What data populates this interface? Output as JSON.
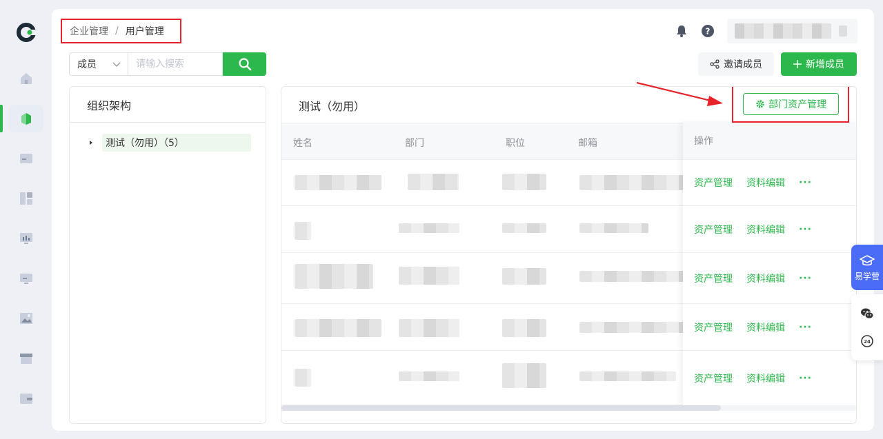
{
  "colors": {
    "brand": "#2db84d",
    "highlight": "#e8222a",
    "learn": "#4a6cf7"
  },
  "sidebar": {
    "logo_icon": "brand-logo-icon",
    "items": [
      {
        "icon": "home-icon"
      },
      {
        "icon": "org-icon",
        "active": true
      },
      {
        "icon": "folder-icon"
      },
      {
        "icon": "grid-icon"
      },
      {
        "icon": "monitor-chart-icon"
      },
      {
        "icon": "display-icon"
      },
      {
        "icon": "image-icon"
      },
      {
        "icon": "box-icon"
      },
      {
        "icon": "wallet-icon"
      }
    ]
  },
  "breadcrumb": {
    "first": "企业管理",
    "separator": "/",
    "current": "用户管理"
  },
  "header": {
    "bell_icon": "bell-icon",
    "help_icon": "help-icon"
  },
  "search": {
    "type_label": "成员",
    "placeholder": "请输入搜索"
  },
  "actions": {
    "invite_label": "邀请成员",
    "add_label": "新增成员"
  },
  "org": {
    "title": "组织架构",
    "tree": [
      {
        "label": "测试（勿用）（5）"
      }
    ]
  },
  "list": {
    "title": "测试（勿用）",
    "dept_asset_label": "部门资产管理",
    "columns": [
      "姓名",
      "部门",
      "职位",
      "邮箱",
      "操作"
    ],
    "row_actions": {
      "asset": "资产管理",
      "edit": "资料编辑",
      "more": "···"
    }
  },
  "float": {
    "learn_label": "易学营"
  }
}
